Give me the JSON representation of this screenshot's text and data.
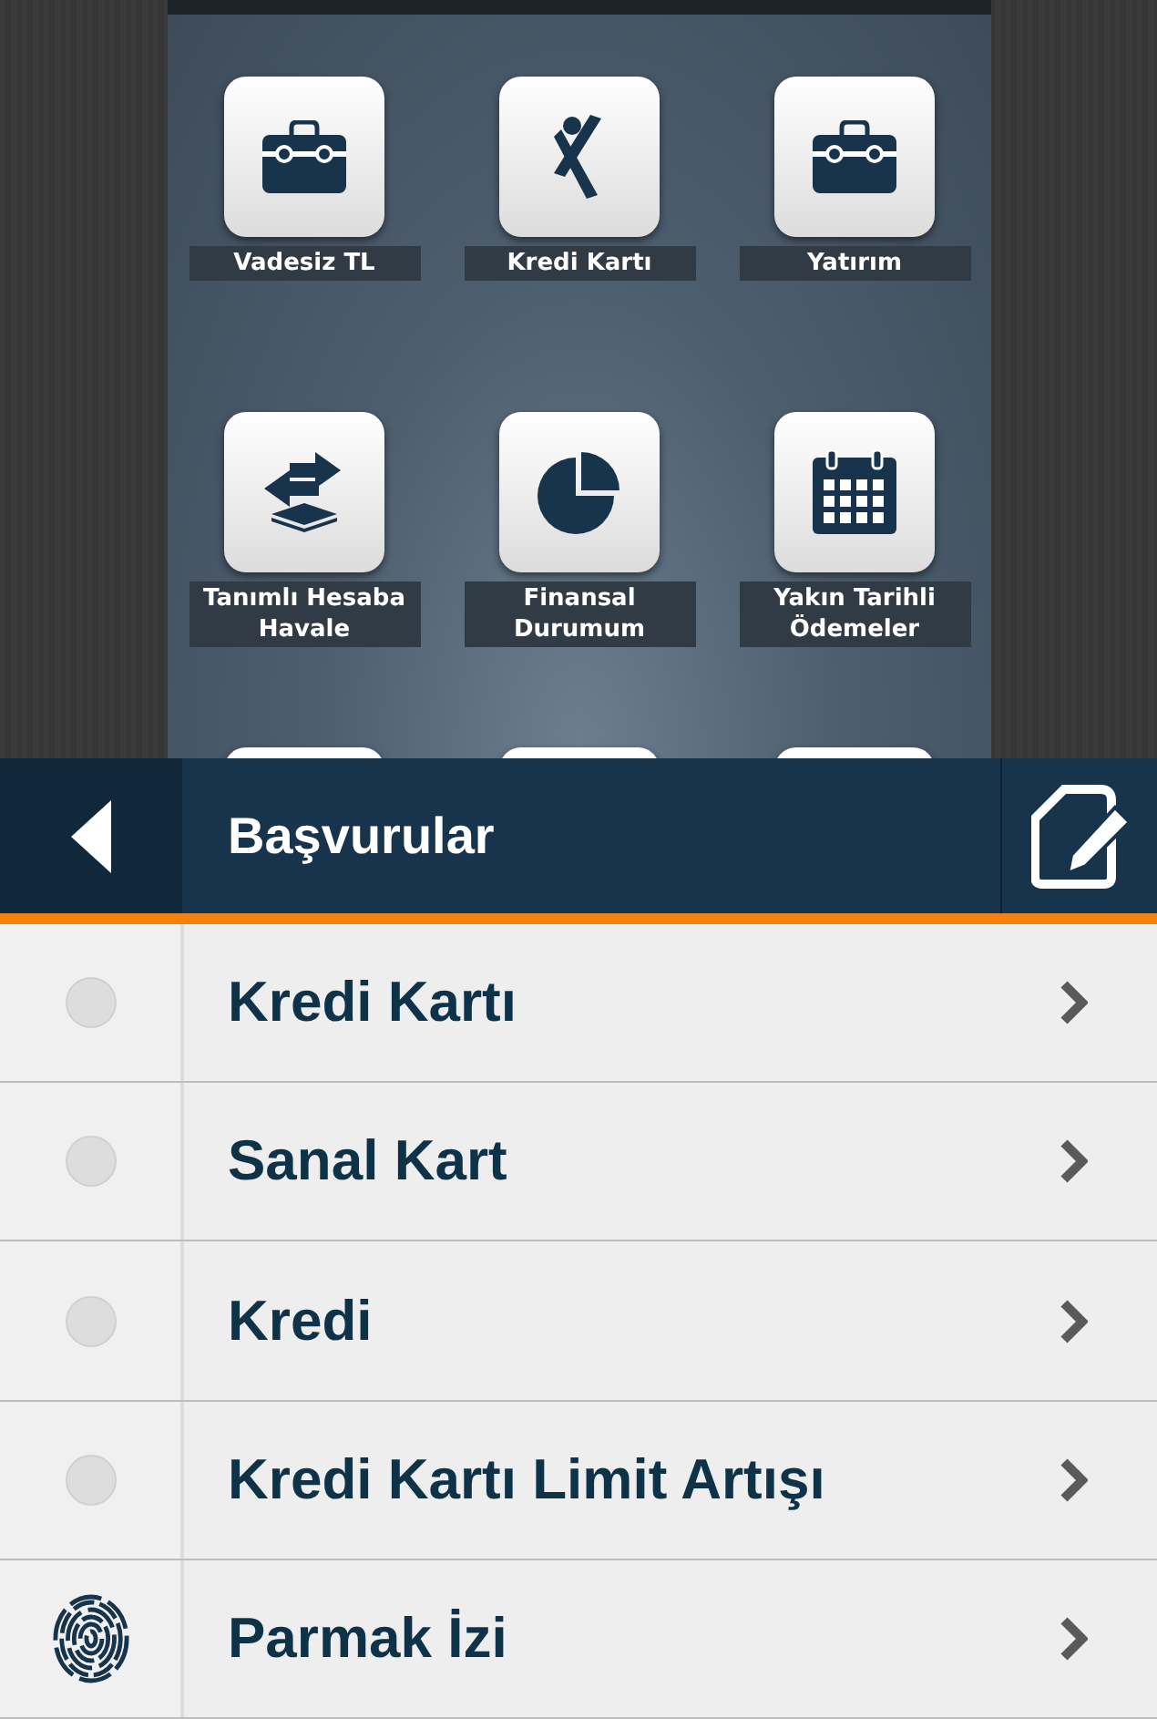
{
  "tiles": [
    {
      "kind": "briefcase",
      "label": "Vadesiz TL"
    },
    {
      "kind": "figure",
      "label": "Kredi Kartı"
    },
    {
      "kind": "briefcase",
      "label": "Yatırım"
    },
    {
      "kind": "transfer",
      "label": "Tanımlı Hesaba Havale"
    },
    {
      "kind": "pie",
      "label": "Finansal Durumum"
    },
    {
      "kind": "calendar",
      "label": "Yakın Tarihli Ödemeler"
    },
    {
      "kind": "hidden"
    },
    {
      "kind": "hidden"
    },
    {
      "kind": "hidden"
    }
  ],
  "sheet": {
    "title": "Başvurular",
    "items": [
      {
        "kind": "dot",
        "label": "Kredi Kartı"
      },
      {
        "kind": "dot",
        "label": "Sanal Kart"
      },
      {
        "kind": "dot",
        "label": "Kredi"
      },
      {
        "kind": "dot",
        "label": "Kredi Kartı Limit Artışı"
      },
      {
        "kind": "fingerprint",
        "label": "Parmak İzi"
      }
    ]
  }
}
